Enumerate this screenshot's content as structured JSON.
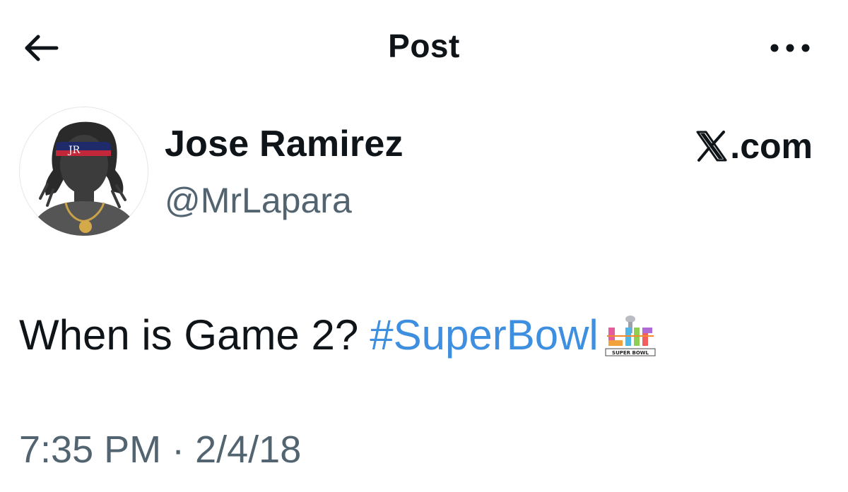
{
  "header": {
    "title": "Post",
    "back_icon": "arrow-left-icon",
    "more_icon": "more-horizontal-icon"
  },
  "author": {
    "display_name": "Jose Ramirez",
    "handle": "@MrLapara",
    "avatar_icon": "avatar-silhouette"
  },
  "source": {
    "label": ".com",
    "logo_icon": "x-logo-icon"
  },
  "tweet": {
    "text": "When is Game 2?",
    "hashtag": "#SuperBowl",
    "hashtag_emoji": "superbowl-lii-emoji",
    "emoji_caption": "SUPER BOWL"
  },
  "meta": {
    "timestamp": "7:35 PM · 2/4/18"
  },
  "colors": {
    "text": "#0f1419",
    "secondary": "#536471",
    "link": "#3e8fe0"
  }
}
